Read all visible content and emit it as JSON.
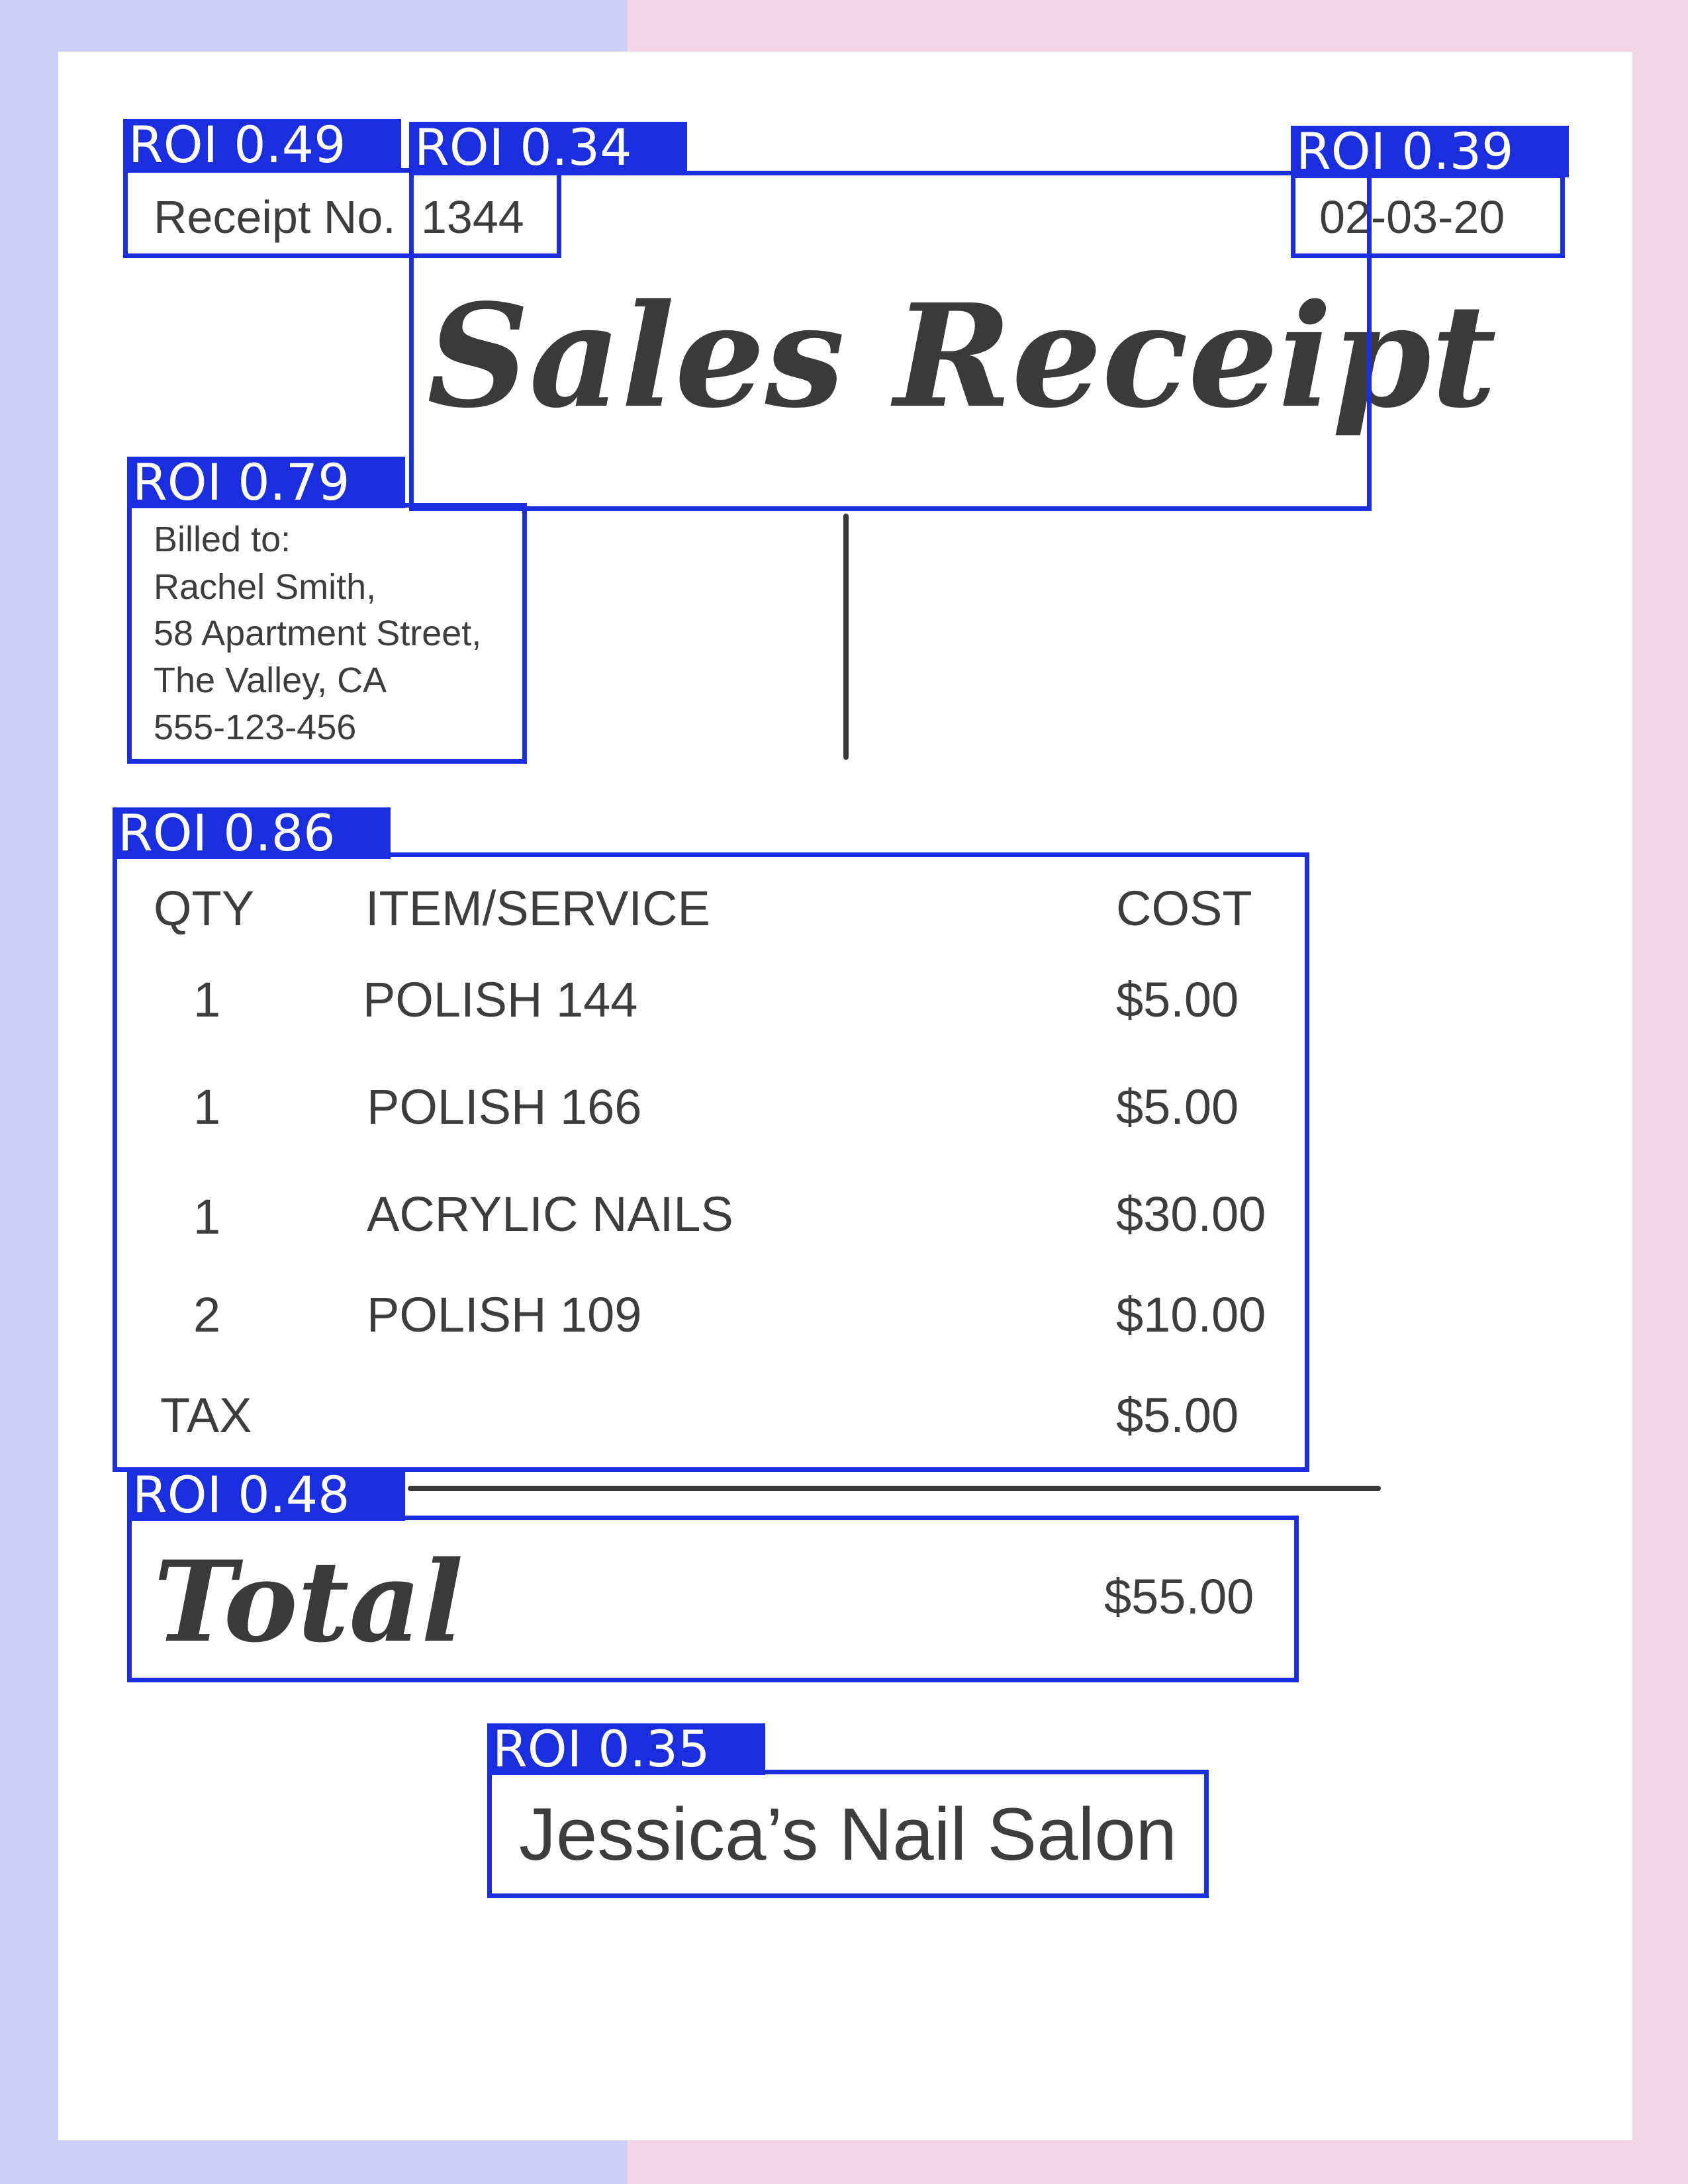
{
  "receipt": {
    "receipt_no_label": "Receipt No.",
    "receipt_no": "1344",
    "date": "02-03-20",
    "title": "Sales Receipt",
    "billed_to": {
      "label": "Billed to:",
      "name": "Rachel Smith,",
      "street": "58 Apartment Street,",
      "city": "The Valley, CA",
      "phone": "555-123-456"
    },
    "table": {
      "headers": {
        "qty": "QTY",
        "item": "ITEM/SERVICE",
        "cost": "COST"
      },
      "rows": [
        {
          "qty": "1",
          "item": "POLISH 144",
          "cost": "$5.00"
        },
        {
          "qty": "1",
          "item": "POLISH 166",
          "cost": "$5.00"
        },
        {
          "qty": "1",
          "item": "ACRYLIC NAILS",
          "cost": "$30.00"
        },
        {
          "qty": "2",
          "item": "POLISH 109",
          "cost": "$10.00"
        }
      ],
      "tax_label": "TAX",
      "tax_value": "$5.00"
    },
    "total_label": "Total",
    "total_value": "$55.00",
    "business_name": "Jessica’s Nail Salon"
  },
  "detections": [
    {
      "label": "ROI 0.49"
    },
    {
      "label": "ROI 0.34"
    },
    {
      "label": "ROI 0.39"
    },
    {
      "label": "ROI 0.79"
    },
    {
      "label": "ROI 0.86"
    },
    {
      "label": "ROI 0.48"
    },
    {
      "label": "ROI 0.35"
    }
  ],
  "colors": {
    "bg_left": "#cbd1f5",
    "bg_right": "#f3d5e6",
    "paper": "#ffffff",
    "text": "#3d3d3d",
    "roi_box": "#1a2ee0"
  }
}
